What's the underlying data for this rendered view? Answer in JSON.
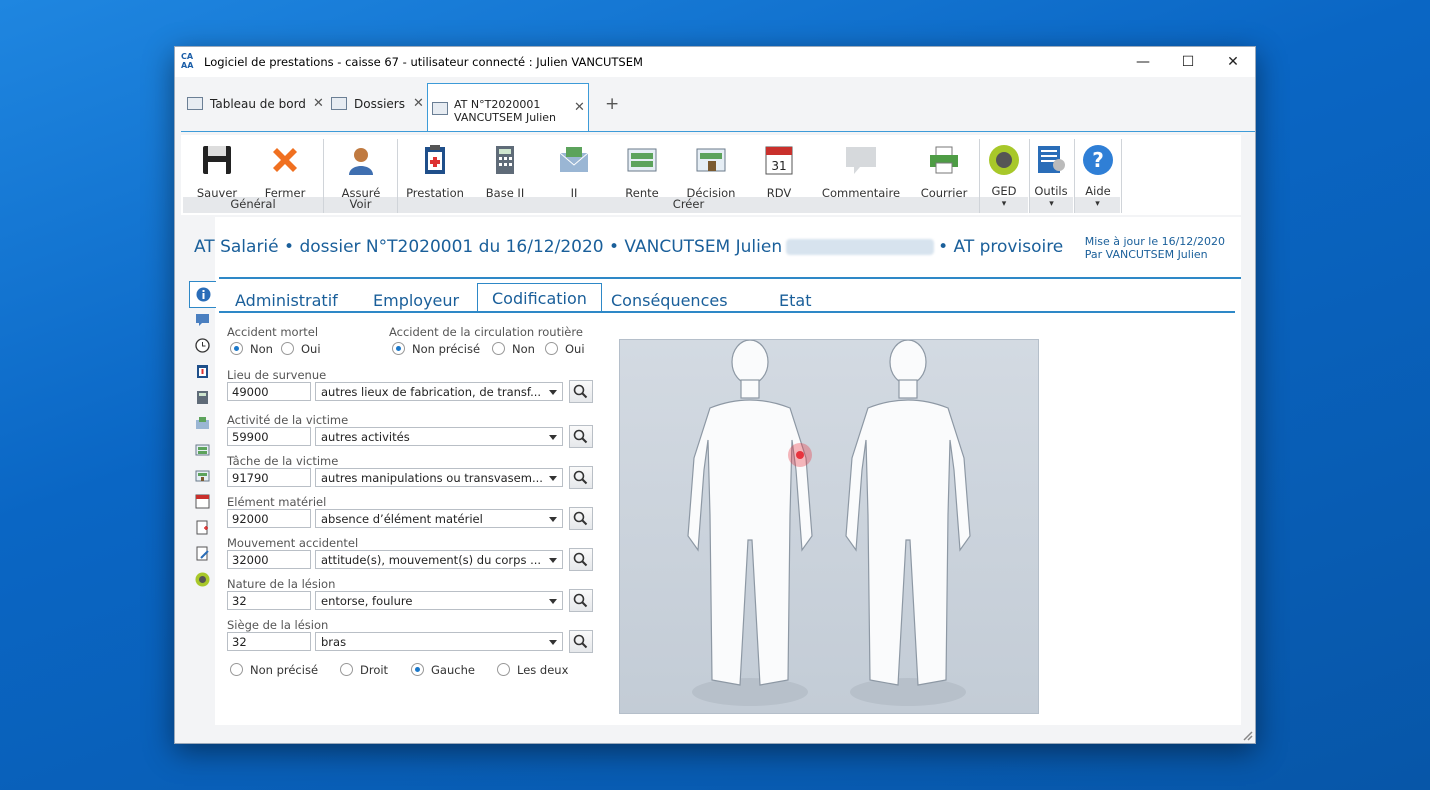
{
  "window": {
    "title": "Logiciel de prestations - caisse 67 - utilisateur connecté : Julien VANCUTSEM",
    "logo": "CA AA",
    "controls": {
      "minimize": "—",
      "maximize": "☐",
      "close": "✕"
    }
  },
  "doctabs": [
    {
      "label": "Tableau de bord",
      "icon": "chart-icon"
    },
    {
      "label": "Dossiers",
      "icon": "folder-icon"
    },
    {
      "label": "AT N°T2020001 VANCUTSEM Julien",
      "line1": "AT N°T2020001",
      "line2": "VANCUTSEM Julien",
      "icon": "file-icon",
      "active": true
    }
  ],
  "newtab": "+",
  "ribbon": {
    "buttons": [
      {
        "label": "Sauver",
        "icon": "save-icon"
      },
      {
        "label": "Fermer",
        "icon": "close-icon"
      },
      {
        "label": "Assuré",
        "icon": "person-icon"
      },
      {
        "label": "Prestation",
        "icon": "clipboard-icon"
      },
      {
        "label": "Base IJ",
        "icon": "calculator-icon"
      },
      {
        "label": "IJ",
        "icon": "envelope-money-icon"
      },
      {
        "label": "Rente",
        "icon": "money-icon"
      },
      {
        "label": "Décision",
        "icon": "stamp-icon"
      },
      {
        "label": "RDV",
        "icon": "calendar-icon"
      },
      {
        "label": "Commentaire",
        "icon": "comment-icon"
      },
      {
        "label": "Courrier",
        "icon": "printer-icon"
      },
      {
        "label": "GED",
        "icon": "ged-icon"
      },
      {
        "label": "Outils",
        "icon": "tools-icon"
      },
      {
        "label": "Aide",
        "icon": "help-icon"
      }
    ],
    "groups": {
      "general": "Général",
      "voir": "Voir",
      "creer": "Créer",
      "dropdown": "▾"
    },
    "colors": {
      "accent": "#1a5f9a",
      "tabline": "#2e88c7"
    }
  },
  "header": {
    "title_part1": "AT Salarié • dossier N°T2020001 du 16/12/2020 • VANCUTSEM Julien",
    "title_part2": "• AT provisoire",
    "update_line1": "Mise à jour le 16/12/2020",
    "update_line2": "Par VANCUTSEM Julien"
  },
  "tabs": [
    "Administratif",
    "Employeur",
    "Codification",
    "Conséquences",
    "Etat"
  ],
  "active_tab": "Codification",
  "form": {
    "accident_mortel": {
      "label": "Accident mortel",
      "options": [
        "Non",
        "Oui"
      ],
      "selected": "Non"
    },
    "accident_circulation": {
      "label": "Accident de la circulation routière",
      "options": [
        "Non précisé",
        "Non",
        "Oui"
      ],
      "selected": "Non précisé"
    },
    "fields": [
      {
        "label": "Lieu de survenue",
        "code": "49000",
        "value": "autres lieux de fabrication, de transf..."
      },
      {
        "label": "Activité de la victime",
        "code": "59900",
        "value": "autres activités"
      },
      {
        "label": "Tâche de la victime",
        "code": "91790",
        "value": "autres manipulations ou transvasem..."
      },
      {
        "label": "Elément matériel",
        "code": "92000",
        "value": "absence d’élément matériel"
      },
      {
        "label": "Mouvement accidentel",
        "code": "32000",
        "value": "attitude(s), mouvement(s) du corps ..."
      },
      {
        "label": "Nature de la lésion",
        "code": "32",
        "value": "entorse, foulure"
      },
      {
        "label": "Siège de la lésion",
        "code": "32",
        "value": "bras"
      }
    ],
    "cote": {
      "options": [
        "Non précisé",
        "Droit",
        "Gauche",
        "Les deux"
      ],
      "selected": "Gauche"
    }
  },
  "body_diagram": {
    "marker_color": "#e8343f",
    "marker_side": "left-arm"
  }
}
